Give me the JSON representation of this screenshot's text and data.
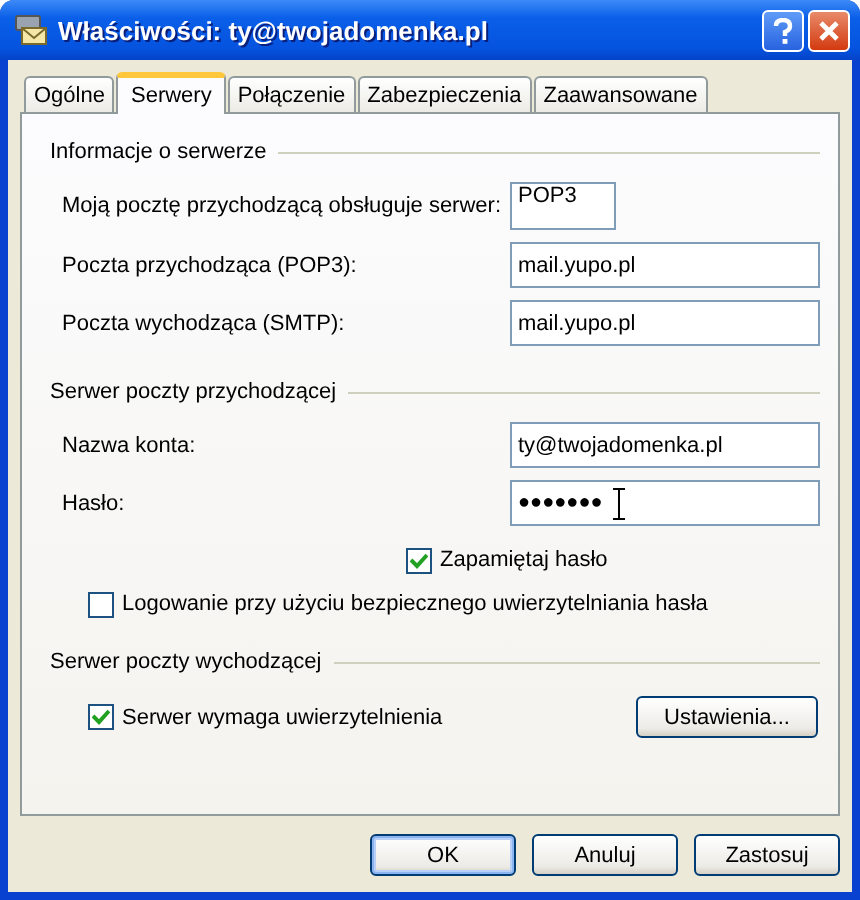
{
  "window": {
    "title": "Właściwości: ty@twojadomenka.pl"
  },
  "tabs": [
    {
      "label": "Ogólne",
      "selected": false
    },
    {
      "label": "Serwery",
      "selected": true
    },
    {
      "label": "Połączenie",
      "selected": false
    },
    {
      "label": "Zabezpieczenia",
      "selected": false
    },
    {
      "label": "Zaawansowane",
      "selected": false
    }
  ],
  "sections": [
    {
      "heading": "Informacje o serwerze",
      "rows": [
        {
          "kind": "short-field",
          "label": "Moją pocztę przychodzącą obsługuje serwer:",
          "value": "POP3"
        },
        {
          "kind": "field",
          "label": "Poczta przychodząca (POP3):",
          "value": "mail.yupo.pl"
        },
        {
          "kind": "field",
          "label": "Poczta wychodząca (SMTP):",
          "value": "mail.yupo.pl"
        }
      ]
    },
    {
      "heading": "Serwer poczty przychodzącej",
      "rows": [
        {
          "kind": "field",
          "label": "Nazwa konta:",
          "value": "ty@twojadomenka.pl"
        },
        {
          "kind": "password",
          "label": "Hasło:",
          "value": "●●●●●●●"
        },
        {
          "kind": "aligned-checkbox",
          "label": "Zapamiętaj hasło",
          "checked": true
        },
        {
          "kind": "checkbox",
          "label": "Logowanie przy użyciu bezpiecznego uwierzytelniania hasła",
          "checked": false
        }
      ]
    },
    {
      "heading": "Serwer poczty wychodzącej",
      "rows": [
        {
          "kind": "checkbox-button",
          "label": "Serwer wymaga uwierzytelnienia",
          "checked": true,
          "button": "Ustawienia..."
        }
      ]
    }
  ],
  "buttons": [
    {
      "label": "OK",
      "default": true
    },
    {
      "label": "Anuluj",
      "default": false
    },
    {
      "label": "Zastosuj",
      "default": false
    }
  ]
}
